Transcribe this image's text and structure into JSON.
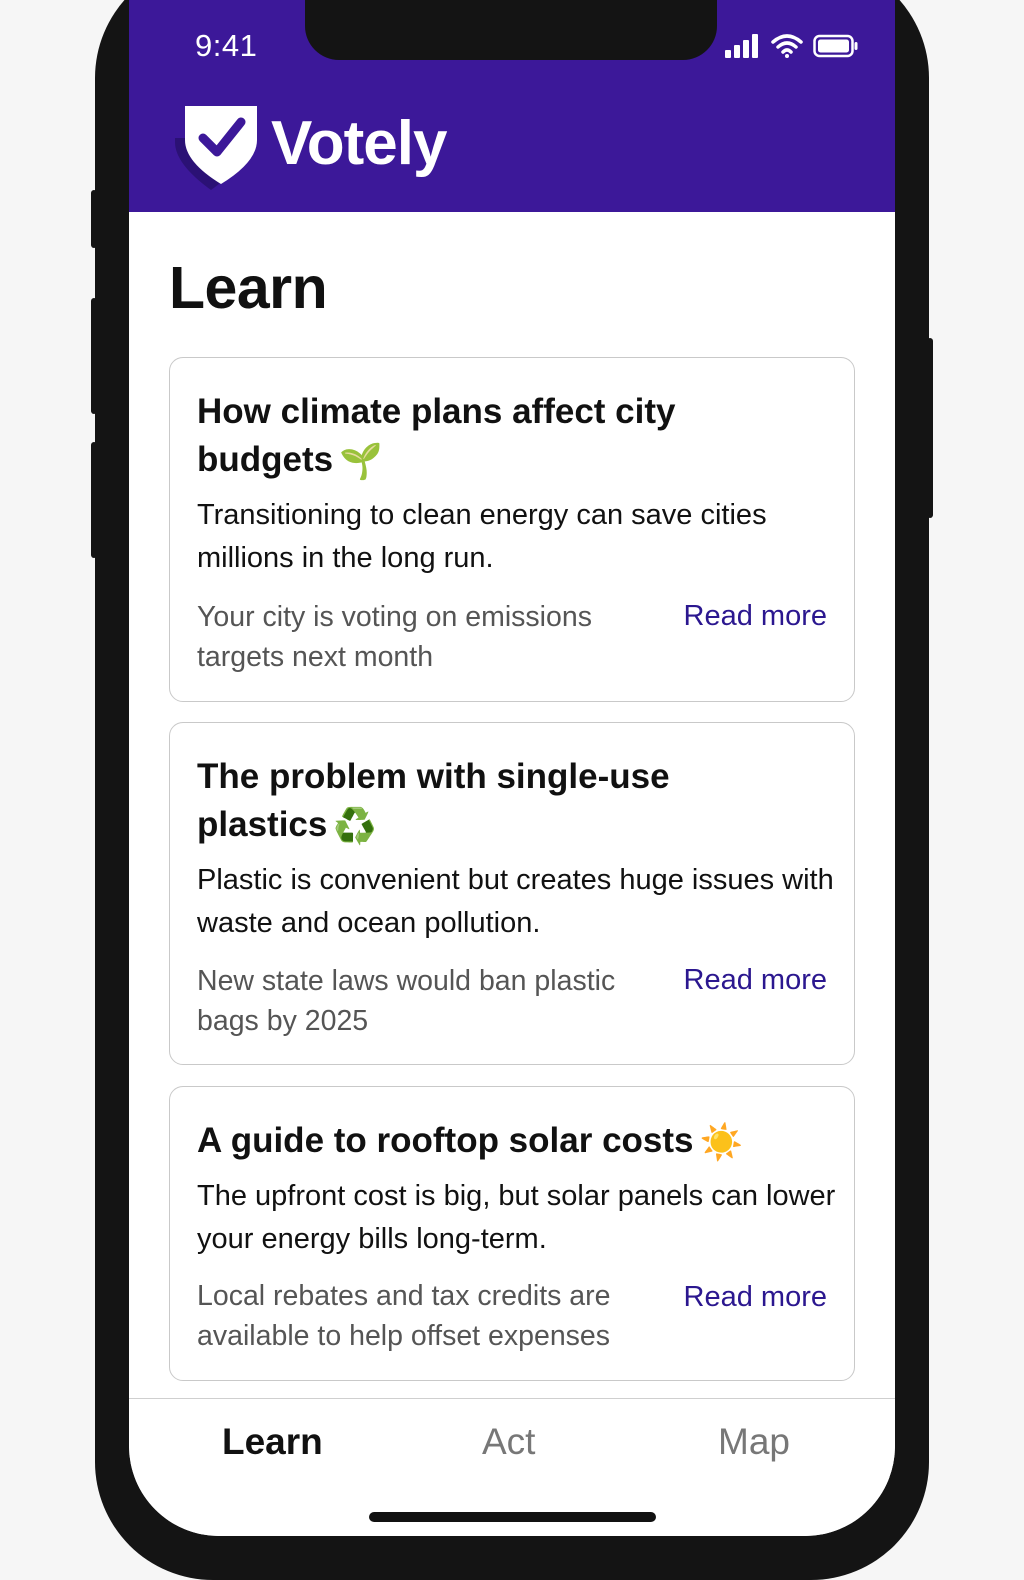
{
  "status": {
    "time": "9:41"
  },
  "app": {
    "name": "Votely",
    "logo_icon": "shield-check-icon"
  },
  "colors": {
    "brand": "#3c1899",
    "link": "#2b178f"
  },
  "page": {
    "title": "Learn"
  },
  "cards": [
    {
      "title": "How climate plans affect city budgets",
      "emoji": "🌱",
      "description": "Transitioning to clean energy can save cities millions in the long run.",
      "note": "Your city is voting on emissions targets next month",
      "link": "Read more"
    },
    {
      "title": "The problem with single-use plastics",
      "emoji": "♻️",
      "description": "Plastic is convenient but creates huge issues with waste and ocean pollution.",
      "note": "New state laws would ban plastic bags by 2025",
      "link": "Read more"
    },
    {
      "title": "A guide to rooftop solar costs",
      "emoji": "☀️",
      "description": "The upfront cost is big, but solar panels can lower your energy bills long-term.",
      "note": "Local rebates and tax credits are available to help offset expenses",
      "link": "Read more"
    }
  ],
  "tabs": [
    {
      "label": "Learn",
      "active": true
    },
    {
      "label": "Act",
      "active": false
    },
    {
      "label": "Map",
      "active": false
    }
  ]
}
